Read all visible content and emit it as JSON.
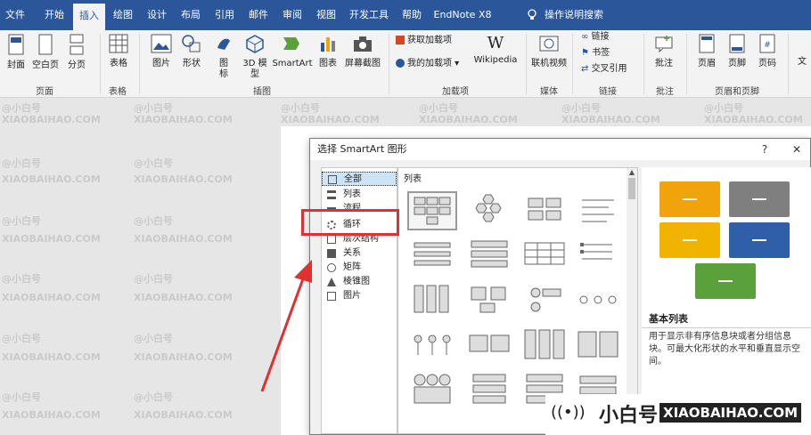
{
  "tabs": [
    "文件",
    "开始",
    "插入",
    "绘图",
    "设计",
    "布局",
    "引用",
    "邮件",
    "审阅",
    "视图",
    "开发工具",
    "帮助",
    "EndNote X8"
  ],
  "search_label": "操作说明搜索",
  "ribbon": {
    "cover": "封面",
    "blank": "空白页",
    "pagebreak": "分页",
    "table": "表格",
    "picture": "图片",
    "shape": "形状",
    "icon": "图\n标",
    "model3d": "3D 模\n型",
    "smartart": "SmartArt",
    "chart": "图表",
    "screenshot": "屏幕截图",
    "get_addins": "获取加载项",
    "my_addins": "我的加载项",
    "wikipedia": "Wikipedia",
    "online_video": "联机视频",
    "link": "链接",
    "bookmark": "书签",
    "crossref": "交叉引用",
    "comment": "批注",
    "header": "页眉",
    "footer": "页脚",
    "pagenum": "页码",
    "textbox": "文",
    "groups": {
      "pages": "页面",
      "table": "表格",
      "illus": "插图",
      "addins": "加载项",
      "media": "媒体",
      "links": "链接",
      "comments": "批注",
      "hf": "页眉和页脚"
    }
  },
  "dialog": {
    "title": "选择 SmartArt 图形",
    "help": "?",
    "close": "✕",
    "left_items": [
      "全部",
      "列表",
      "流程",
      "循环",
      "层次结构",
      "关系",
      "矩阵",
      "棱锥图",
      "图片"
    ],
    "mid_header": "列表",
    "preview_title": "基本列表",
    "preview_desc": "用于显示非有序信息块或者分组信息块。可最大化形状的水平和垂直显示空间。"
  },
  "colors": {
    "tab_bg": "#2b579a",
    "orange": "#f0a30a",
    "gray": "#7f7f7f",
    "blue": "#2e5fa8",
    "green": "#5aa13c",
    "red": "#e03030"
  },
  "watermark": {
    "a": "@小白号",
    "b": "XIAOBAIHAO.COM"
  },
  "brand": {
    "cn": "小白号",
    "en": "XIAOBAIHAO.COM"
  }
}
